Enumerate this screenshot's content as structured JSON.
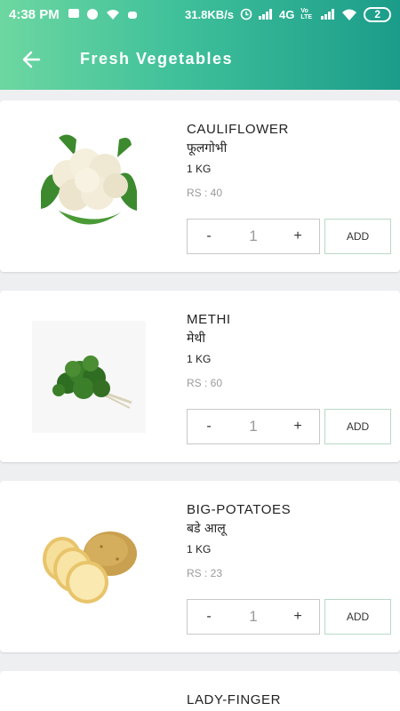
{
  "status_bar": {
    "time": "4:38 PM",
    "network_speed": "31.8KB/s",
    "network_type": "4G",
    "volte": "Vo LTE",
    "battery": "2"
  },
  "header": {
    "title": "Fresh Vegetables",
    "back_icon": "arrow-left-icon"
  },
  "products": [
    {
      "name": "CAULIFLOWER",
      "hindi": "फूलगोभी",
      "weight": "1 KG",
      "price": "RS : 40",
      "qty": "1",
      "add": "ADD",
      "minus": "-",
      "plus": "+"
    },
    {
      "name": "METHI",
      "hindi": "मेथी",
      "weight": "1 KG",
      "price": "RS : 60",
      "qty": "1",
      "add": "ADD",
      "minus": "-",
      "plus": "+"
    },
    {
      "name": "BIG-POTATOES",
      "hindi": "बडे आलू",
      "weight": "1 KG",
      "price": "RS : 23",
      "qty": "1",
      "add": "ADD",
      "minus": "-",
      "plus": "+"
    },
    {
      "name": "LADY-FINGER"
    }
  ],
  "colors": {
    "header_start": "#6dd7a1",
    "header_end": "#1b9c8a",
    "add_border": "#b8d9c7"
  }
}
